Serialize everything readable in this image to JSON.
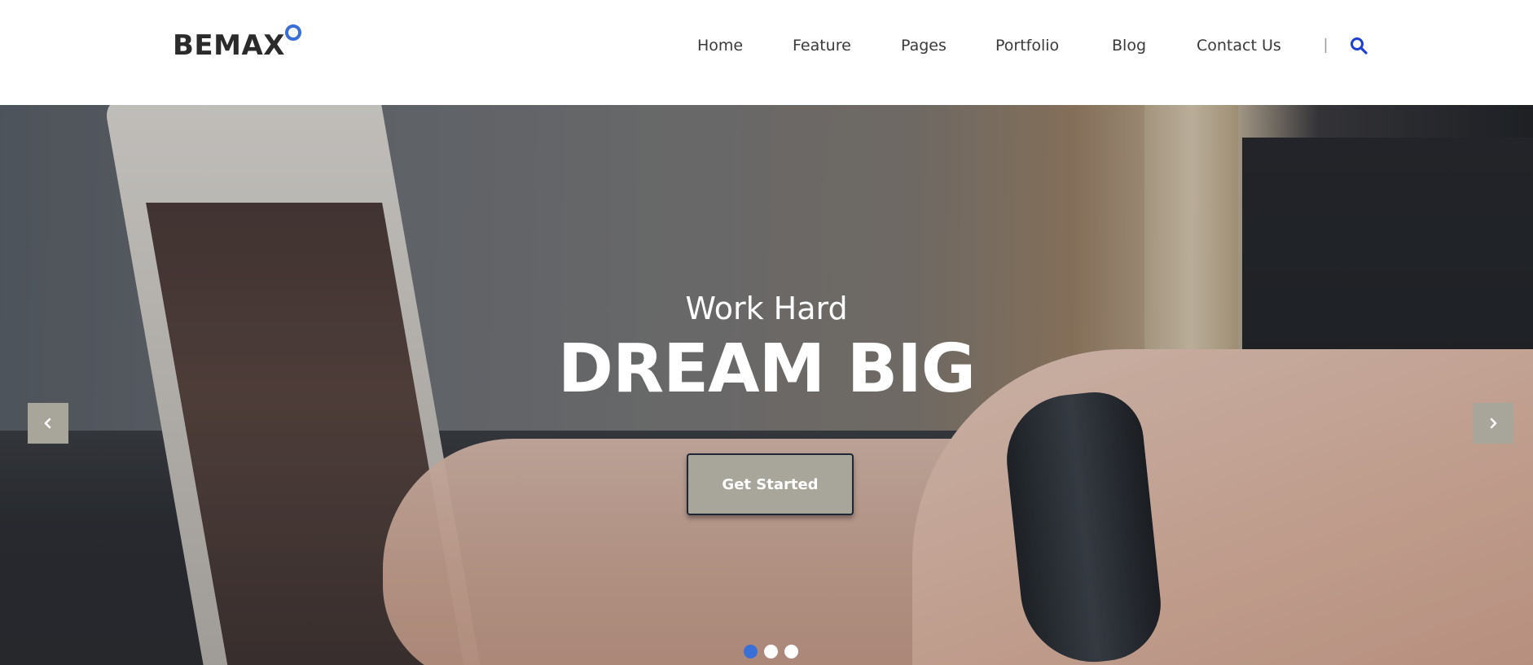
{
  "brand": {
    "name": "BEMAX",
    "accent_color": "#3b6fd8"
  },
  "nav": {
    "items": [
      {
        "label": "Home"
      },
      {
        "label": "Feature"
      },
      {
        "label": "Pages"
      },
      {
        "label": "Portfolio"
      },
      {
        "label": "Blog"
      },
      {
        "label": "Contact Us"
      }
    ],
    "separator": "|",
    "search_icon": "search-icon"
  },
  "hero": {
    "kicker": "Work Hard",
    "title": "DREAM BIG",
    "cta_label": "Get Started",
    "prev_icon": "chevron-left-icon",
    "next_icon": "chevron-right-icon",
    "slides": [
      {
        "active": true
      },
      {
        "active": false
      },
      {
        "active": false
      }
    ],
    "button_color": "#a8a59a"
  }
}
